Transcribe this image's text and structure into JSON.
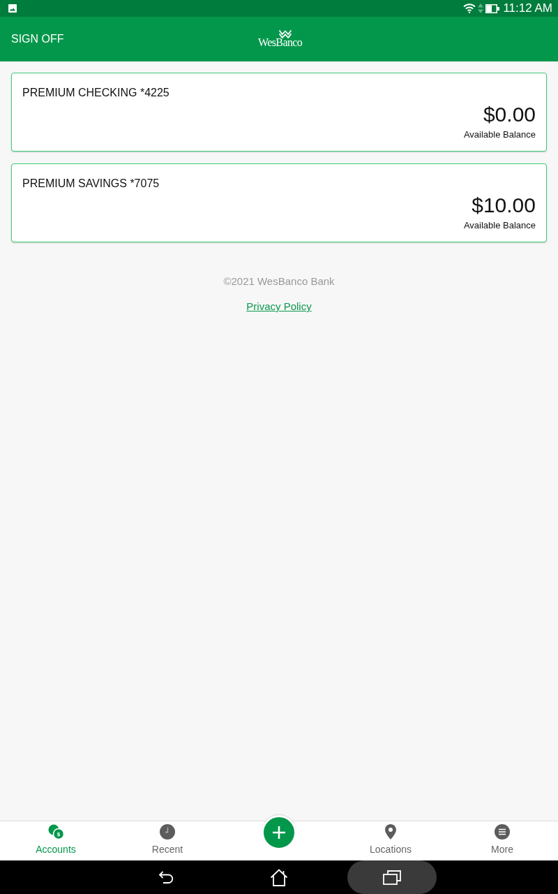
{
  "status_bar": {
    "time": "11:12 AM"
  },
  "app_bar": {
    "sign_off": "SIGN OFF",
    "logo": "WesBanco"
  },
  "accounts": [
    {
      "name": "PREMIUM CHECKING *4225",
      "balance": "$0.00",
      "balance_label": "Available Balance"
    },
    {
      "name": "PREMIUM SAVINGS *7075",
      "balance": "$10.00",
      "balance_label": "Available Balance"
    }
  ],
  "footer": {
    "copyright": "©2021 WesBanco Bank",
    "privacy_link": "Privacy Policy"
  },
  "bottom_nav": [
    {
      "label": "Accounts",
      "selected": true,
      "icon_glyph": "$"
    },
    {
      "label": "Recent",
      "selected": false
    },
    {
      "label": "Locations",
      "selected": false
    },
    {
      "label": "More",
      "selected": false
    }
  ]
}
